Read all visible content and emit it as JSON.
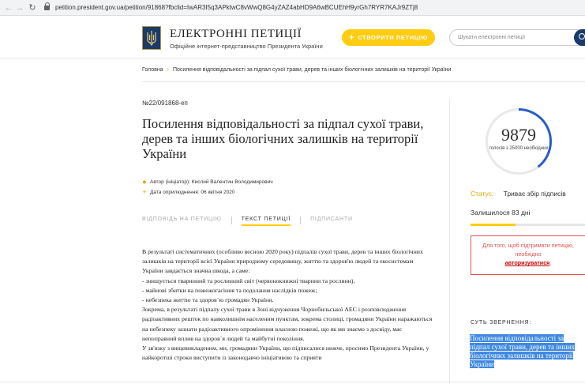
{
  "browser": {
    "url": "petition.president.gov.ua/petition/91868?fbclid=IwAR3I5q3APktwC8vWwQ8G4yZAZ4abHD9A6wBCUEhH9yrGh7RYR7KAJr9ZTj8"
  },
  "header": {
    "title": "ЕЛЕКТРОННІ ПЕТИЦІЇ",
    "subtitle": "Офіційне інтернет-представництво Президента України",
    "create_button": "СТВОРИТИ ПЕТИЦІЮ",
    "search_placeholder": "Шукати електронні петиції"
  },
  "breadcrumb": {
    "home": "Головна",
    "current": "Посилення відповідальності за підпал сухої трави, дерев та інших біологічних залишків на території України"
  },
  "petition": {
    "number": "№22/091868-еп",
    "title": "Посилення відповідальності за підпал сухої трави, дерев та інших біологічних залишків на території України",
    "author": "Автор (ініціатор): Кислий Валентин Володимирович",
    "date": "Дата оприлюднення: 06 квітня 2020",
    "tabs": [
      {
        "label": "ВІДПОВІДЬ НА ПЕТИЦІЮ",
        "active": false
      },
      {
        "label": "ТЕКСТ ПЕТИЦІЇ",
        "active": true
      },
      {
        "label": "ПІДПИСАНТИ",
        "active": false
      }
    ],
    "body": [
      "В результаті систематичних (особливо весною 2020 року) підпалів сухої трави, дерев та інших біологічних залишків на території всієї України природному середовищу, життю та здоров'ю людей та екосистемам України завдається значна шкода, а саме:",
      "- знищується тваринний та рослинний світ (червонокнижні тварини та рослини),",
      "- майнові збитки на пожежогасіння та подолання наслідків пожеж;",
      "- небезпека життю та здоров`ю громадян України.",
      "Зокрема, в результаті підпалу сухої трави в Зоні відчуження Чорнобильської АЕС і розповсюдження радіоактивних решток по навколишнім населеним пунктам, зокрема столиці, громадяни України наражаються на небезпеку зазнати радіоактивного опромінення власною пожежі, що як ми знаємо з досвіду, має непоправний вплив на здоров`я людей та майбутні покоління.",
      "У зв'язку з вищевикладеним, ми, громадяни України, що підписалися нижче, просимо Президента України, у найкоротші строки виступити із законодавчо ініціативою та сприяти"
    ]
  },
  "sidebar": {
    "votes": "9879",
    "votes_caption": "голосів з 25000 необхідних",
    "votes_required": 25000,
    "status_label": "Статус:",
    "status_value": "Триває збір підписів",
    "days_left": "Залишилося 83 дні",
    "progress_fraction": 0.3952,
    "warning_text": "Для того, щоб підтримати петицію, необхідно",
    "warning_link": "авторизуватися",
    "essence_label": "СУТЬ ЗВЕРНЕННЯ:",
    "essence_text": "Посилення відповідальності за підпал сухої трави, дерев та інших біологічних залишків на території України"
  },
  "colors": {
    "accent": "#ffcc11",
    "navy": "#1a3a6b",
    "progress_blue": "#2a5cc8",
    "warn_red": "#e05050",
    "selection": "#3f88e0"
  }
}
